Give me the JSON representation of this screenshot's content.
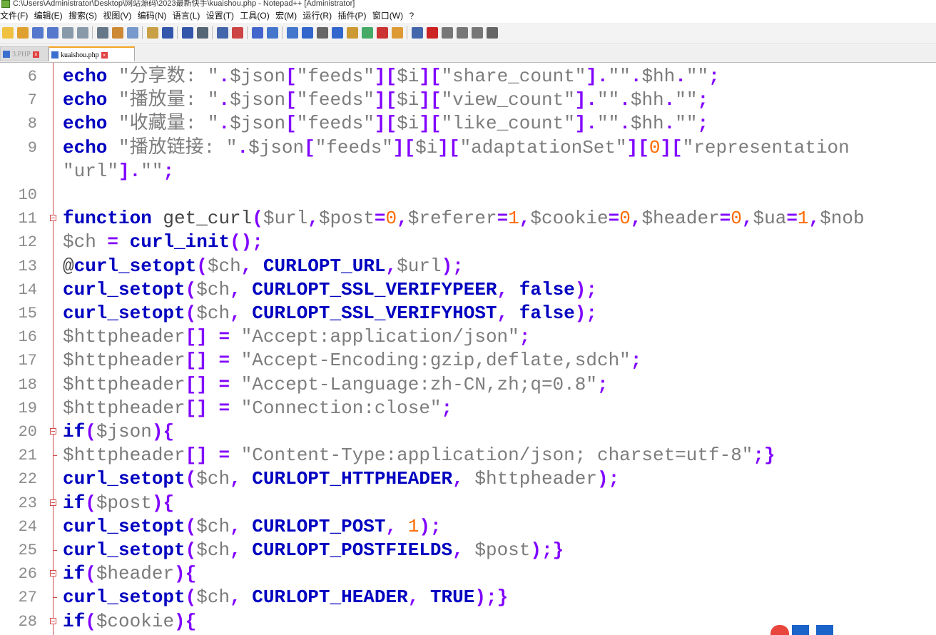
{
  "window": {
    "title": "C:\\Users\\Administrator\\Desktop\\网站源码\\2023最新快手\\kuaishou.php - Notepad++ [Administrator]"
  },
  "menu": [
    "文件(F)",
    "编辑(E)",
    "搜索(S)",
    "视图(V)",
    "编码(N)",
    "语言(L)",
    "设置(T)",
    "工具(O)",
    "宏(M)",
    "运行(R)",
    "插件(P)",
    "窗口(W)",
    "?"
  ],
  "tabs": [
    {
      "label": "3.PHP",
      "active": false
    },
    {
      "label": "kuaishou.php",
      "active": true
    }
  ],
  "colors": {
    "keyword": "#0000c0",
    "string": "#7d7d7d",
    "number": "#ff6a00",
    "operator": "#8000ff",
    "line_number": "#8c8c8c",
    "fold_marker": "#d14b4b"
  },
  "toolbar_icons": [
    "new-file-icon",
    "open-file-icon",
    "save-icon",
    "save-all-icon",
    "close-icon",
    "close-all-icon",
    "print-icon",
    "cut-icon",
    "copy-icon",
    "paste-icon",
    "undo-icon",
    "redo-icon",
    "find-icon",
    "replace-icon",
    "zoom-in-icon",
    "zoom-out-icon",
    "sync-v-icon",
    "sync-h-icon",
    "word-wrap-icon",
    "show-all-chars-icon",
    "indent-guide-icon",
    "udl-icon",
    "doc-map-icon",
    "function-list-icon",
    "folder-workspace-icon",
    "monitor-icon",
    "record-macro-icon",
    "stop-macro-icon",
    "play-macro-icon",
    "run-macro-multi-icon",
    "save-macro-icon"
  ],
  "code_lines": [
    {
      "num": "6",
      "fold": "",
      "tokens": [
        [
          "kw",
          "echo"
        ],
        [
          "pl",
          " "
        ],
        [
          "str",
          "\"分享数: \""
        ],
        [
          "op",
          "."
        ],
        [
          "var",
          "$json"
        ],
        [
          "op",
          "["
        ],
        [
          "str",
          "\"feeds\""
        ],
        [
          "op",
          "]["
        ],
        [
          "var",
          "$i"
        ],
        [
          "op",
          "]["
        ],
        [
          "str",
          "\"share_count\""
        ],
        [
          "op",
          "]."
        ],
        [
          "str",
          "\"\""
        ],
        [
          "op",
          "."
        ],
        [
          "var",
          "$hh"
        ],
        [
          "op",
          "."
        ],
        [
          "str",
          "\"\""
        ],
        [
          "op",
          ";"
        ]
      ]
    },
    {
      "num": "7",
      "fold": "",
      "tokens": [
        [
          "kw",
          "echo"
        ],
        [
          "pl",
          " "
        ],
        [
          "str",
          "\"播放量: \""
        ],
        [
          "op",
          "."
        ],
        [
          "var",
          "$json"
        ],
        [
          "op",
          "["
        ],
        [
          "str",
          "\"feeds\""
        ],
        [
          "op",
          "]["
        ],
        [
          "var",
          "$i"
        ],
        [
          "op",
          "]["
        ],
        [
          "str",
          "\"view_count\""
        ],
        [
          "op",
          "]."
        ],
        [
          "str",
          "\"\""
        ],
        [
          "op",
          "."
        ],
        [
          "var",
          "$hh"
        ],
        [
          "op",
          "."
        ],
        [
          "str",
          "\"\""
        ],
        [
          "op",
          ";"
        ]
      ]
    },
    {
      "num": "8",
      "fold": "",
      "tokens": [
        [
          "kw",
          "echo"
        ],
        [
          "pl",
          " "
        ],
        [
          "str",
          "\"收藏量: \""
        ],
        [
          "op",
          "."
        ],
        [
          "var",
          "$json"
        ],
        [
          "op",
          "["
        ],
        [
          "str",
          "\"feeds\""
        ],
        [
          "op",
          "]["
        ],
        [
          "var",
          "$i"
        ],
        [
          "op",
          "]["
        ],
        [
          "str",
          "\"like_count\""
        ],
        [
          "op",
          "]."
        ],
        [
          "str",
          "\"\""
        ],
        [
          "op",
          "."
        ],
        [
          "var",
          "$hh"
        ],
        [
          "op",
          "."
        ],
        [
          "str",
          "\"\""
        ],
        [
          "op",
          ";"
        ]
      ]
    },
    {
      "num": "9",
      "fold": "",
      "tokens": [
        [
          "kw",
          "echo"
        ],
        [
          "pl",
          " "
        ],
        [
          "str",
          "\"播放链接: \""
        ],
        [
          "op",
          "."
        ],
        [
          "var",
          "$json"
        ],
        [
          "op",
          "["
        ],
        [
          "str",
          "\"feeds\""
        ],
        [
          "op",
          "]["
        ],
        [
          "var",
          "$i"
        ],
        [
          "op",
          "]["
        ],
        [
          "str",
          "\"adaptationSet\""
        ],
        [
          "op",
          "]["
        ],
        [
          "num",
          "0"
        ],
        [
          "op",
          "]["
        ],
        [
          "str",
          "\"representation"
        ]
      ]
    },
    {
      "num": "",
      "fold": "",
      "tokens": [
        [
          "str",
          "\"url\""
        ],
        [
          "op",
          "]."
        ],
        [
          "str",
          "\"\""
        ],
        [
          "op",
          ";"
        ]
      ]
    },
    {
      "num": "10",
      "fold": "",
      "tokens": []
    },
    {
      "num": "11",
      "fold": "open",
      "tokens": [
        [
          "kw",
          "function"
        ],
        [
          "pl",
          " get_curl"
        ],
        [
          "op",
          "("
        ],
        [
          "var",
          "$url"
        ],
        [
          "op",
          ","
        ],
        [
          "var",
          "$post"
        ],
        [
          "op",
          "="
        ],
        [
          "num",
          "0"
        ],
        [
          "op",
          ","
        ],
        [
          "var",
          "$referer"
        ],
        [
          "op",
          "="
        ],
        [
          "num",
          "1"
        ],
        [
          "op",
          ","
        ],
        [
          "var",
          "$cookie"
        ],
        [
          "op",
          "="
        ],
        [
          "num",
          "0"
        ],
        [
          "op",
          ","
        ],
        [
          "var",
          "$header"
        ],
        [
          "op",
          "="
        ],
        [
          "num",
          "0"
        ],
        [
          "op",
          ","
        ],
        [
          "var",
          "$ua"
        ],
        [
          "op",
          "="
        ],
        [
          "num",
          "1"
        ],
        [
          "op",
          ","
        ],
        [
          "var",
          "$nob"
        ]
      ]
    },
    {
      "num": "12",
      "fold": "",
      "tokens": [
        [
          "var",
          "$ch"
        ],
        [
          "pl",
          " "
        ],
        [
          "op",
          "="
        ],
        [
          "pl",
          " "
        ],
        [
          "kw",
          "curl_init"
        ],
        [
          "op",
          "();"
        ]
      ]
    },
    {
      "num": "13",
      "fold": "",
      "tokens": [
        [
          "pl",
          "@"
        ],
        [
          "kw",
          "curl_setopt"
        ],
        [
          "op",
          "("
        ],
        [
          "var",
          "$ch"
        ],
        [
          "op",
          ","
        ],
        [
          "pl",
          " "
        ],
        [
          "kw",
          "CURLOPT_URL"
        ],
        [
          "op",
          ","
        ],
        [
          "var",
          "$url"
        ],
        [
          "op",
          ");"
        ]
      ]
    },
    {
      "num": "14",
      "fold": "",
      "tokens": [
        [
          "kw",
          "curl_setopt"
        ],
        [
          "op",
          "("
        ],
        [
          "var",
          "$ch"
        ],
        [
          "op",
          ","
        ],
        [
          "pl",
          " "
        ],
        [
          "kw",
          "CURLOPT_SSL_VERIFYPEER"
        ],
        [
          "op",
          ","
        ],
        [
          "pl",
          " "
        ],
        [
          "kw",
          "false"
        ],
        [
          "op",
          ");"
        ]
      ]
    },
    {
      "num": "15",
      "fold": "",
      "tokens": [
        [
          "kw",
          "curl_setopt"
        ],
        [
          "op",
          "("
        ],
        [
          "var",
          "$ch"
        ],
        [
          "op",
          ","
        ],
        [
          "pl",
          " "
        ],
        [
          "kw",
          "CURLOPT_SSL_VERIFYHOST"
        ],
        [
          "op",
          ","
        ],
        [
          "pl",
          " "
        ],
        [
          "kw",
          "false"
        ],
        [
          "op",
          ");"
        ]
      ]
    },
    {
      "num": "16",
      "fold": "",
      "tokens": [
        [
          "var",
          "$httpheader"
        ],
        [
          "op",
          "[]"
        ],
        [
          "pl",
          " "
        ],
        [
          "op",
          "="
        ],
        [
          "pl",
          " "
        ],
        [
          "str",
          "\"Accept:application/json\""
        ],
        [
          "op",
          ";"
        ]
      ]
    },
    {
      "num": "17",
      "fold": "",
      "tokens": [
        [
          "var",
          "$httpheader"
        ],
        [
          "op",
          "[]"
        ],
        [
          "pl",
          " "
        ],
        [
          "op",
          "="
        ],
        [
          "pl",
          " "
        ],
        [
          "str",
          "\"Accept-Encoding:gzip,deflate,sdch\""
        ],
        [
          "op",
          ";"
        ]
      ]
    },
    {
      "num": "18",
      "fold": "",
      "tokens": [
        [
          "var",
          "$httpheader"
        ],
        [
          "op",
          "[]"
        ],
        [
          "pl",
          " "
        ],
        [
          "op",
          "="
        ],
        [
          "pl",
          " "
        ],
        [
          "str",
          "\"Accept-Language:zh-CN,zh;q=0.8\""
        ],
        [
          "op",
          ";"
        ]
      ]
    },
    {
      "num": "19",
      "fold": "",
      "tokens": [
        [
          "var",
          "$httpheader"
        ],
        [
          "op",
          "[]"
        ],
        [
          "pl",
          " "
        ],
        [
          "op",
          "="
        ],
        [
          "pl",
          " "
        ],
        [
          "str",
          "\"Connection:close\""
        ],
        [
          "op",
          ";"
        ]
      ]
    },
    {
      "num": "20",
      "fold": "open",
      "tokens": [
        [
          "kw",
          "if"
        ],
        [
          "op",
          "("
        ],
        [
          "var",
          "$json"
        ],
        [
          "op",
          ")"
        ],
        [
          "op",
          "{"
        ]
      ]
    },
    {
      "num": "21",
      "fold": "end",
      "tokens": [
        [
          "var",
          "$httpheader"
        ],
        [
          "op",
          "[]"
        ],
        [
          "pl",
          " "
        ],
        [
          "op",
          "="
        ],
        [
          "pl",
          " "
        ],
        [
          "str",
          "\"Content-Type:application/json; charset=utf-8\""
        ],
        [
          "op",
          ";}"
        ]
      ]
    },
    {
      "num": "22",
      "fold": "",
      "tokens": [
        [
          "kw",
          "curl_setopt"
        ],
        [
          "op",
          "("
        ],
        [
          "var",
          "$ch"
        ],
        [
          "op",
          ","
        ],
        [
          "pl",
          " "
        ],
        [
          "kw",
          "CURLOPT_HTTPHEADER"
        ],
        [
          "op",
          ","
        ],
        [
          "pl",
          " "
        ],
        [
          "var",
          "$httpheader"
        ],
        [
          "op",
          ");"
        ]
      ]
    },
    {
      "num": "23",
      "fold": "open",
      "tokens": [
        [
          "kw",
          "if"
        ],
        [
          "op",
          "("
        ],
        [
          "var",
          "$post"
        ],
        [
          "op",
          ")"
        ],
        [
          "op",
          "{"
        ]
      ]
    },
    {
      "num": "24",
      "fold": "",
      "tokens": [
        [
          "kw",
          "curl_setopt"
        ],
        [
          "op",
          "("
        ],
        [
          "var",
          "$ch"
        ],
        [
          "op",
          ","
        ],
        [
          "pl",
          " "
        ],
        [
          "kw",
          "CURLOPT_POST"
        ],
        [
          "op",
          ","
        ],
        [
          "pl",
          " "
        ],
        [
          "num",
          "1"
        ],
        [
          "op",
          ");"
        ]
      ]
    },
    {
      "num": "25",
      "fold": "end",
      "tokens": [
        [
          "kw",
          "curl_setopt"
        ],
        [
          "op",
          "("
        ],
        [
          "var",
          "$ch"
        ],
        [
          "op",
          ","
        ],
        [
          "pl",
          " "
        ],
        [
          "kw",
          "CURLOPT_POSTFIELDS"
        ],
        [
          "op",
          ","
        ],
        [
          "pl",
          " "
        ],
        [
          "var",
          "$post"
        ],
        [
          "op",
          ");}"
        ]
      ]
    },
    {
      "num": "26",
      "fold": "open",
      "tokens": [
        [
          "kw",
          "if"
        ],
        [
          "op",
          "("
        ],
        [
          "var",
          "$header"
        ],
        [
          "op",
          ")"
        ],
        [
          "op",
          "{"
        ]
      ]
    },
    {
      "num": "27",
      "fold": "end",
      "tokens": [
        [
          "kw",
          "curl_setopt"
        ],
        [
          "op",
          "("
        ],
        [
          "var",
          "$ch"
        ],
        [
          "op",
          ","
        ],
        [
          "pl",
          " "
        ],
        [
          "kw",
          "CURLOPT_HEADER"
        ],
        [
          "op",
          ","
        ],
        [
          "pl",
          " "
        ],
        [
          "kw",
          "TRUE"
        ],
        [
          "op",
          ");}"
        ]
      ]
    },
    {
      "num": "28",
      "fold": "open",
      "tokens": [
        [
          "kw",
          "if"
        ],
        [
          "op",
          "("
        ],
        [
          "var",
          "$cookie"
        ],
        [
          "op",
          ")"
        ],
        [
          "op",
          "{"
        ]
      ]
    }
  ]
}
